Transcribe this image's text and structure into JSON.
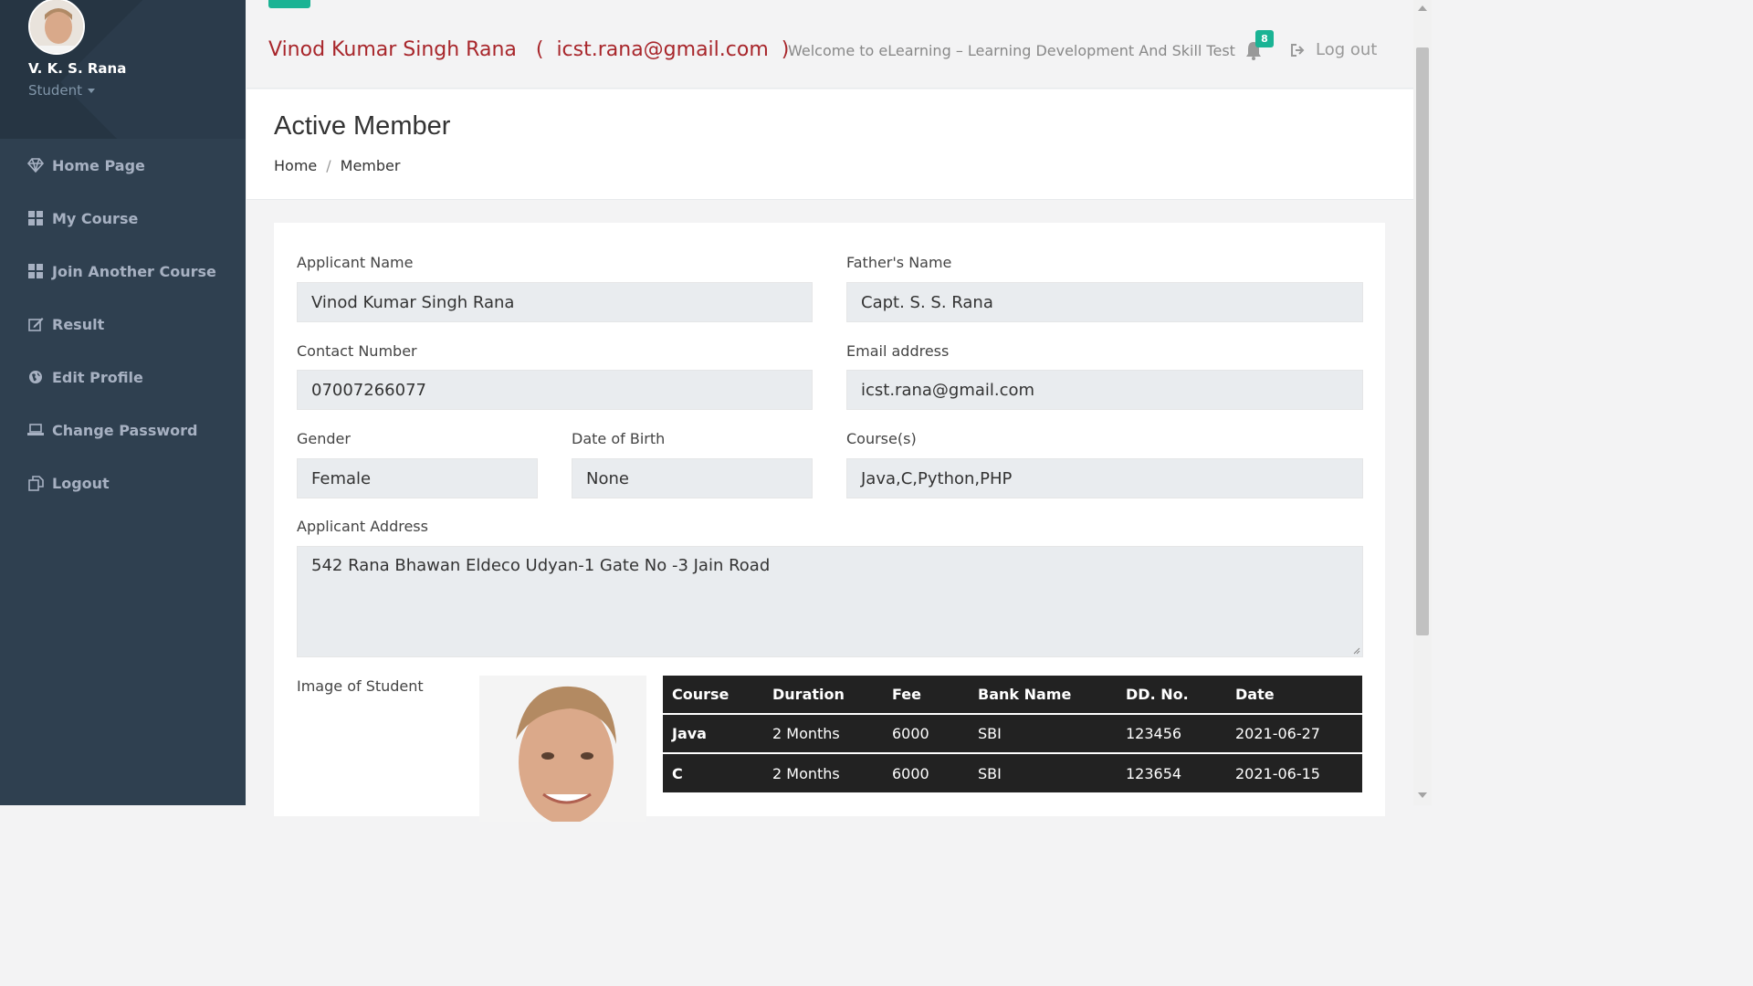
{
  "sidebar": {
    "profile": {
      "name": "V. K. S. Rana",
      "role": "Student"
    },
    "items": [
      {
        "label": "Home Page",
        "icon": "diamond-icon"
      },
      {
        "label": "My Course",
        "icon": "th-large-icon"
      },
      {
        "label": "Join Another Course",
        "icon": "th-large-icon"
      },
      {
        "label": "Result",
        "icon": "edit-icon"
      },
      {
        "label": "Edit Profile",
        "icon": "globe-icon"
      },
      {
        "label": "Change Password",
        "icon": "laptop-icon"
      },
      {
        "label": "Logout",
        "icon": "copy-icon"
      }
    ]
  },
  "header": {
    "user_title": "Vinod Kumar Singh Rana   (  icst.rana@gmail.com  )",
    "welcome": "Welcome to eLearning – Learning Development And Skill Test",
    "notification_count": "8",
    "logout_label": "Log out"
  },
  "page": {
    "title": "Active Member",
    "breadcrumb": {
      "home": "Home",
      "separator": "/",
      "current": "Member"
    }
  },
  "form": {
    "applicant_name": {
      "label": "Applicant Name",
      "value": "Vinod Kumar Singh Rana"
    },
    "father_name": {
      "label": "Father's Name",
      "value": "Capt. S. S. Rana"
    },
    "contact": {
      "label": "Contact Number",
      "value": "07007266077"
    },
    "email": {
      "label": "Email address",
      "value": "icst.rana@gmail.com"
    },
    "gender": {
      "label": "Gender",
      "value": "Female"
    },
    "dob": {
      "label": "Date of Birth",
      "value": "None"
    },
    "courses": {
      "label": "Course(s)",
      "value": "Java,C,Python,PHP"
    },
    "address": {
      "label": "Applicant Address",
      "value": "542 Rana Bhawan Eldeco Udyan-1 Gate No -3 Jain Road"
    },
    "image_label": "Image of Student"
  },
  "payments": {
    "headers": [
      "Course",
      "Duration",
      "Fee",
      "Bank Name",
      "DD. No.",
      "Date"
    ],
    "rows": [
      [
        "Java",
        "2 Months",
        "6000",
        "SBI",
        "123456",
        "2021-06-27"
      ],
      [
        "C",
        "2 Months",
        "6000",
        "SBI",
        "123654",
        "2021-06-15"
      ]
    ]
  },
  "colors": {
    "sidebar_bg": "#2f4050",
    "accent": "#1ab394",
    "title_red": "#a8262b"
  }
}
